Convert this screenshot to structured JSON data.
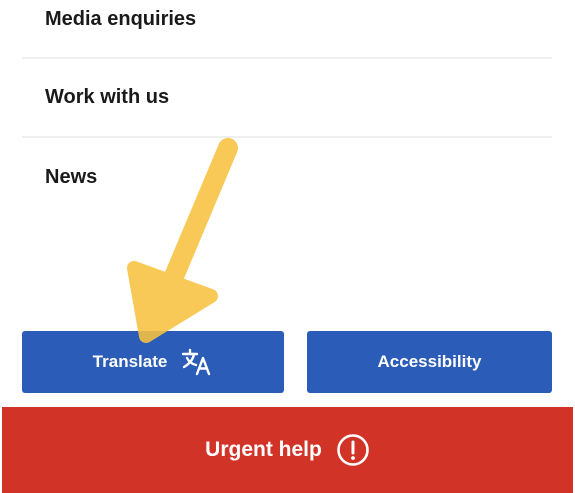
{
  "nav": {
    "items": [
      {
        "label": "Media enquiries"
      },
      {
        "label": "Work with us"
      },
      {
        "label": "News"
      }
    ]
  },
  "buttons": {
    "translate_label": "Translate",
    "translate_icon": "translate-icon",
    "accessibility_label": "Accessibility",
    "urgent_label": "Urgent help",
    "urgent_icon": "alert-circle-icon"
  },
  "annotation": {
    "type": "arrow",
    "color": "#f8c23f",
    "points_to": "translate-button"
  },
  "colors": {
    "primary_button": "#2b5cb8",
    "urgent_button": "#d13427",
    "nav_text": "#1a1a1a",
    "divider": "#efefef"
  }
}
